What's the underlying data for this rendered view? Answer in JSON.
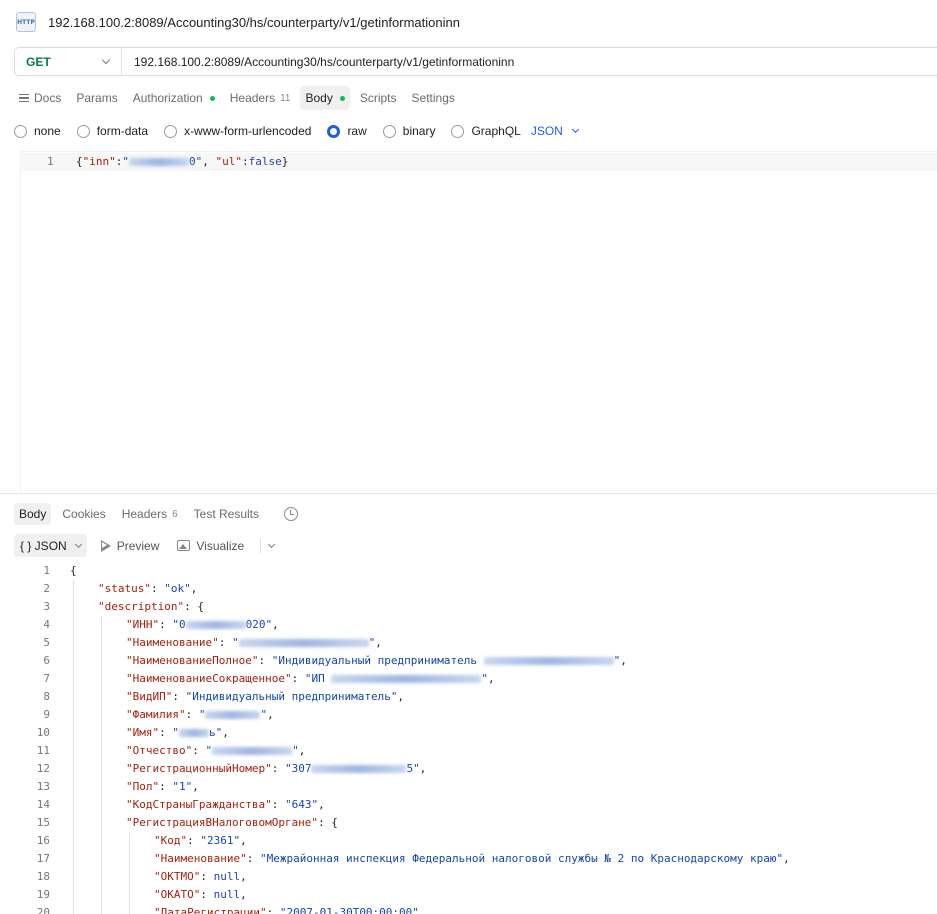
{
  "window": {
    "title": "192.168.100.2:8089/Accounting30/hs/counterparty/v1/getinformationinn",
    "icon": "http-icon"
  },
  "request": {
    "method": "GET",
    "url": "192.168.100.2:8089/Accounting30/hs/counterparty/v1/getinformationinn",
    "tabs": [
      {
        "label": "Docs"
      },
      {
        "label": "Params"
      },
      {
        "label": "Authorization",
        "dot": true
      },
      {
        "label": "Headers",
        "count": "11"
      },
      {
        "label": "Body",
        "dot": true,
        "active": true
      },
      {
        "label": "Scripts"
      },
      {
        "label": "Settings"
      }
    ],
    "body_types": [
      "none",
      "form-data",
      "x-www-form-urlencoded",
      "raw",
      "binary",
      "GraphQL"
    ],
    "body_type_selected": "raw",
    "language": "JSON",
    "body_line_number": "1",
    "body": {
      "open": "{",
      "k_inn": "\"inn\"",
      "colon1": ":",
      "inn_q_open": "\"",
      "inn_tail": "0\"",
      "comma": ", ",
      "k_ul": "\"ul\"",
      "colon2": ":",
      "ul_value": "false",
      "close": "}"
    }
  },
  "response": {
    "tabs": [
      {
        "label": "Body",
        "active": true
      },
      {
        "label": "Cookies"
      },
      {
        "label": "Headers",
        "count": "6"
      },
      {
        "label": "Test Results"
      }
    ],
    "format_label": "{ } JSON",
    "preview_label": "Preview",
    "visualize_label": "Visualize",
    "lines": [
      {
        "n": "1",
        "indent": 0,
        "parts": [
          [
            "p",
            "{"
          ]
        ]
      },
      {
        "n": "2",
        "indent": 1,
        "parts": [
          [
            "k",
            "\"status\""
          ],
          [
            "p",
            ": "
          ],
          [
            "s",
            "\"ok\""
          ],
          [
            "p",
            ","
          ]
        ]
      },
      {
        "n": "3",
        "indent": 1,
        "parts": [
          [
            "k",
            "\"description\""
          ],
          [
            "p",
            ": {"
          ]
        ]
      },
      {
        "n": "4",
        "indent": 2,
        "parts": [
          [
            "k",
            "\"ИНН\""
          ],
          [
            "p",
            ": "
          ],
          [
            "s",
            "\"0"
          ],
          [
            "b",
            "60"
          ],
          [
            "s",
            "020\""
          ],
          [
            "p",
            ","
          ]
        ]
      },
      {
        "n": "5",
        "indent": 2,
        "parts": [
          [
            "k",
            "\"Наименование\""
          ],
          [
            "p",
            ": "
          ],
          [
            "s",
            "\""
          ],
          [
            "b",
            "130"
          ],
          [
            "s",
            "\""
          ],
          [
            "p",
            ","
          ]
        ]
      },
      {
        "n": "6",
        "indent": 2,
        "parts": [
          [
            "k",
            "\"НаименованиеПолное\""
          ],
          [
            "p",
            ": "
          ],
          [
            "s",
            "\"Индивидуальный предприниматель "
          ],
          [
            "b",
            "130"
          ],
          [
            "s",
            "\""
          ],
          [
            "p",
            ","
          ]
        ]
      },
      {
        "n": "7",
        "indent": 2,
        "parts": [
          [
            "k",
            "\"НаименованиеСокращенное\""
          ],
          [
            "p",
            ": "
          ],
          [
            "s",
            "\"ИП "
          ],
          [
            "b",
            "150"
          ],
          [
            "s",
            "\""
          ],
          [
            "p",
            ","
          ]
        ]
      },
      {
        "n": "8",
        "indent": 2,
        "parts": [
          [
            "k",
            "\"ВидИП\""
          ],
          [
            "p",
            ": "
          ],
          [
            "s",
            "\"Индивидуальный предприниматель\""
          ],
          [
            "p",
            ","
          ]
        ]
      },
      {
        "n": "9",
        "indent": 2,
        "parts": [
          [
            "k",
            "\"Фамилия\""
          ],
          [
            "p",
            ": "
          ],
          [
            "s",
            "\""
          ],
          [
            "b",
            "55"
          ],
          [
            "s",
            "\""
          ],
          [
            "p",
            ","
          ]
        ]
      },
      {
        "n": "10",
        "indent": 2,
        "parts": [
          [
            "k",
            "\"Имя\""
          ],
          [
            "p",
            ": "
          ],
          [
            "s",
            "\""
          ],
          [
            "b",
            "30"
          ],
          [
            "s",
            "ь\""
          ],
          [
            "p",
            ","
          ]
        ]
      },
      {
        "n": "11",
        "indent": 2,
        "parts": [
          [
            "k",
            "\"Отчество\""
          ],
          [
            "p",
            ": "
          ],
          [
            "s",
            "\""
          ],
          [
            "b",
            "80"
          ],
          [
            "s",
            "\""
          ],
          [
            "p",
            ","
          ]
        ]
      },
      {
        "n": "12",
        "indent": 2,
        "parts": [
          [
            "k",
            "\"РегистрационныйНомер\""
          ],
          [
            "p",
            ": "
          ],
          [
            "s",
            "\"307"
          ],
          [
            "b",
            "95"
          ],
          [
            "s",
            "5\""
          ],
          [
            "p",
            ","
          ]
        ]
      },
      {
        "n": "13",
        "indent": 2,
        "parts": [
          [
            "k",
            "\"Пол\""
          ],
          [
            "p",
            ": "
          ],
          [
            "s",
            "\"1\""
          ],
          [
            "p",
            ","
          ]
        ]
      },
      {
        "n": "14",
        "indent": 2,
        "parts": [
          [
            "k",
            "\"КодСтраныГражданства\""
          ],
          [
            "p",
            ": "
          ],
          [
            "s",
            "\"643\""
          ],
          [
            "p",
            ","
          ]
        ]
      },
      {
        "n": "15",
        "indent": 2,
        "parts": [
          [
            "k",
            "\"РегистрацияВНалоговомОргане\""
          ],
          [
            "p",
            ": {"
          ]
        ]
      },
      {
        "n": "16",
        "indent": 3,
        "parts": [
          [
            "k",
            "\"Код\""
          ],
          [
            "p",
            ": "
          ],
          [
            "s",
            "\"2361\""
          ],
          [
            "p",
            ","
          ]
        ]
      },
      {
        "n": "17",
        "indent": 3,
        "parts": [
          [
            "k",
            "\"Наименование\""
          ],
          [
            "p",
            ": "
          ],
          [
            "s",
            "\"Межрайонная инспекция Федеральной налоговой службы № 2 по Краснодарскому краю\""
          ],
          [
            "p",
            ","
          ]
        ]
      },
      {
        "n": "18",
        "indent": 3,
        "parts": [
          [
            "k",
            "\"ОКТМО\""
          ],
          [
            "p",
            ": "
          ],
          [
            "v",
            "null"
          ],
          [
            "p",
            ","
          ]
        ]
      },
      {
        "n": "19",
        "indent": 3,
        "parts": [
          [
            "k",
            "\"ОКАТО\""
          ],
          [
            "p",
            ": "
          ],
          [
            "v",
            "null"
          ],
          [
            "p",
            ","
          ]
        ]
      },
      {
        "n": "20",
        "indent": 3,
        "parts": [
          [
            "k",
            "\"ДатаРегистрации\""
          ],
          [
            "p",
            ": "
          ],
          [
            "s",
            "\"2007-01-30T00:00:00\""
          ]
        ]
      }
    ]
  }
}
